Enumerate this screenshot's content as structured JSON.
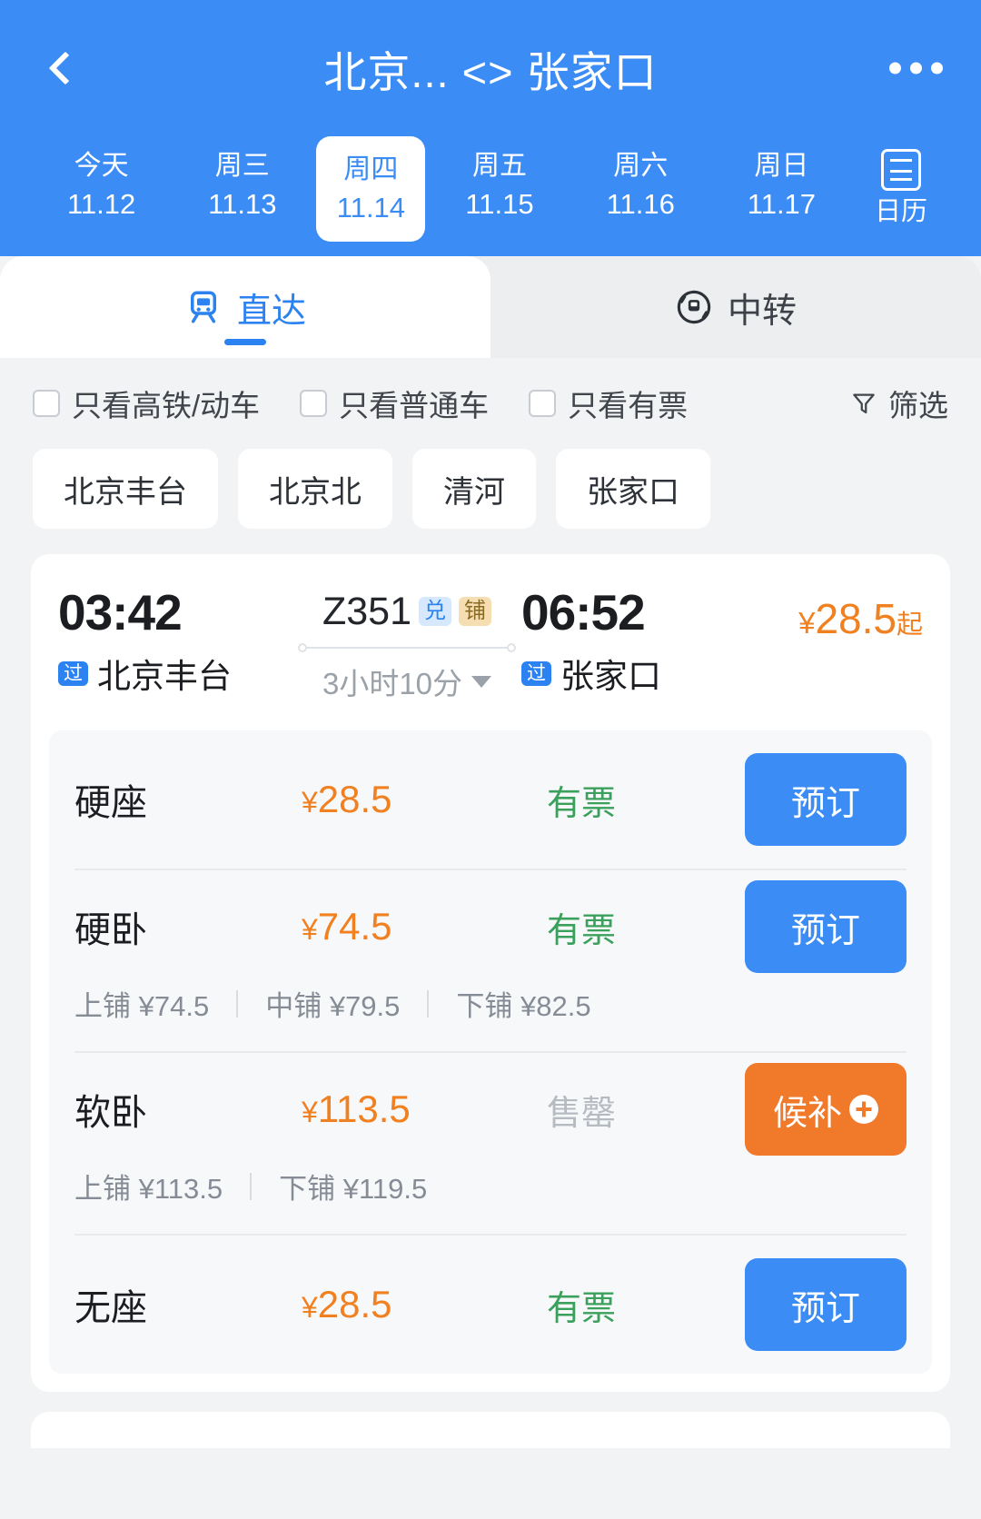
{
  "header": {
    "back_icon": "chevron-left-icon",
    "title": "北京... <> 张家口",
    "more_icon": "more-horizontal-icon",
    "dates": [
      {
        "dow": "今天",
        "date": "11.12",
        "active": false
      },
      {
        "dow": "周三",
        "date": "11.13",
        "active": false
      },
      {
        "dow": "周四",
        "date": "11.14",
        "active": true
      },
      {
        "dow": "周五",
        "date": "11.15",
        "active": false
      },
      {
        "dow": "周六",
        "date": "11.16",
        "active": false
      },
      {
        "dow": "周日",
        "date": "11.17",
        "active": false
      }
    ],
    "calendar": {
      "label": "日历",
      "icon": "calendar-icon"
    }
  },
  "tabs": [
    {
      "label": "直达",
      "icon": "train-icon",
      "active": true
    },
    {
      "label": "中转",
      "icon": "transfer-icon",
      "active": false
    }
  ],
  "filters": {
    "checkboxes": [
      {
        "label": "只看高铁/动车",
        "checked": false
      },
      {
        "label": "只看普通车",
        "checked": false
      },
      {
        "label": "只看有票",
        "checked": false
      }
    ],
    "filter_button": {
      "label": "筛选",
      "icon": "funnel-icon"
    }
  },
  "station_chips": [
    {
      "label": "北京丰台"
    },
    {
      "label": "北京北"
    },
    {
      "label": "清河"
    },
    {
      "label": "张家口"
    }
  ],
  "train": {
    "depart_time": "03:42",
    "depart_station": "北京丰台",
    "depart_pass_badge": "过",
    "arrive_time": "06:52",
    "arrive_station": "张家口",
    "arrive_pass_badge": "过",
    "train_no": "Z351",
    "badges": [
      {
        "text": "兑",
        "style": "blue"
      },
      {
        "text": "铺",
        "style": "tan"
      }
    ],
    "duration": "3小时10分",
    "duration_caret": "caret-down-icon",
    "price_yen": "¥",
    "price_from_value": "28.5",
    "price_from_suffix": "起",
    "seats": [
      {
        "name": "硬座",
        "yen": "¥",
        "price": "28.5",
        "status": "有票",
        "status_type": "ok",
        "action": "预订",
        "action_type": "book",
        "sub_prices": []
      },
      {
        "name": "硬卧",
        "yen": "¥",
        "price": "74.5",
        "status": "有票",
        "status_type": "ok",
        "action": "预订",
        "action_type": "book",
        "sub_prices": [
          "上铺 ¥74.5",
          "中铺 ¥79.5",
          "下铺 ¥82.5"
        ]
      },
      {
        "name": "软卧",
        "yen": "¥",
        "price": "113.5",
        "status": "售罄",
        "status_type": "out",
        "action": "候补",
        "action_type": "wait",
        "action_icon": "plus-circle-icon",
        "sub_prices": [
          "上铺 ¥113.5",
          "下铺 ¥119.5"
        ]
      },
      {
        "name": "无座",
        "yen": "¥",
        "price": "28.5",
        "status": "有票",
        "status_type": "ok",
        "action": "预订",
        "action_type": "book",
        "sub_prices": []
      }
    ]
  },
  "colors": {
    "brand_blue": "#3b8cf5",
    "accent_orange": "#f08020",
    "waitlist_orange": "#f0792a",
    "available_green": "#3ba05c",
    "soldout_gray": "#b6bbc2"
  }
}
